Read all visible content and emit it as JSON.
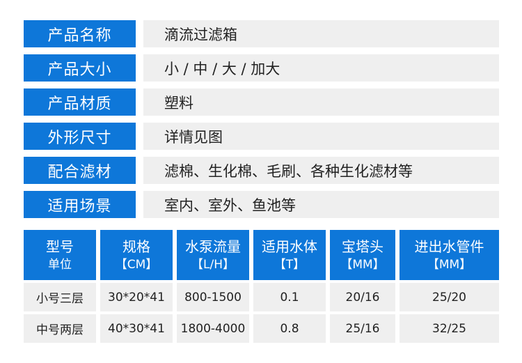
{
  "specs": [
    {
      "label": "产品名称",
      "value": "滴流过滤箱"
    },
    {
      "label": "产品大小",
      "value": "小 / 中 / 大 / 加大"
    },
    {
      "label": "产品材质",
      "value": "塑料"
    },
    {
      "label": "外形尺寸",
      "value": "详情见图"
    },
    {
      "label": "配合滤材",
      "value": "滤棉、生化棉、毛刷、各种生化滤材等"
    },
    {
      "label": "适用场景",
      "value": "室内、室外、鱼池等"
    }
  ],
  "table": {
    "headers": [
      {
        "main": "型号",
        "sub": "单位"
      },
      {
        "main": "规格",
        "sub": "【CM】"
      },
      {
        "main": "水泵流量",
        "sub": "【L/H】"
      },
      {
        "main": "适用水体",
        "sub": "【T】"
      },
      {
        "main": "宝塔头",
        "sub": "【MM】"
      },
      {
        "main": "进出水管件",
        "sub": "【MM】"
      }
    ],
    "rows": [
      [
        "小号三层",
        "30*20*41",
        "800-1500",
        "0.1",
        "20/16",
        "25/20"
      ],
      [
        "中号两层",
        "40*30*41",
        "1800-4000",
        "0.8",
        "25/16",
        "32/25"
      ]
    ]
  },
  "colors": {
    "accent": "#0e77d9",
    "cell_bg": "#efefef"
  }
}
